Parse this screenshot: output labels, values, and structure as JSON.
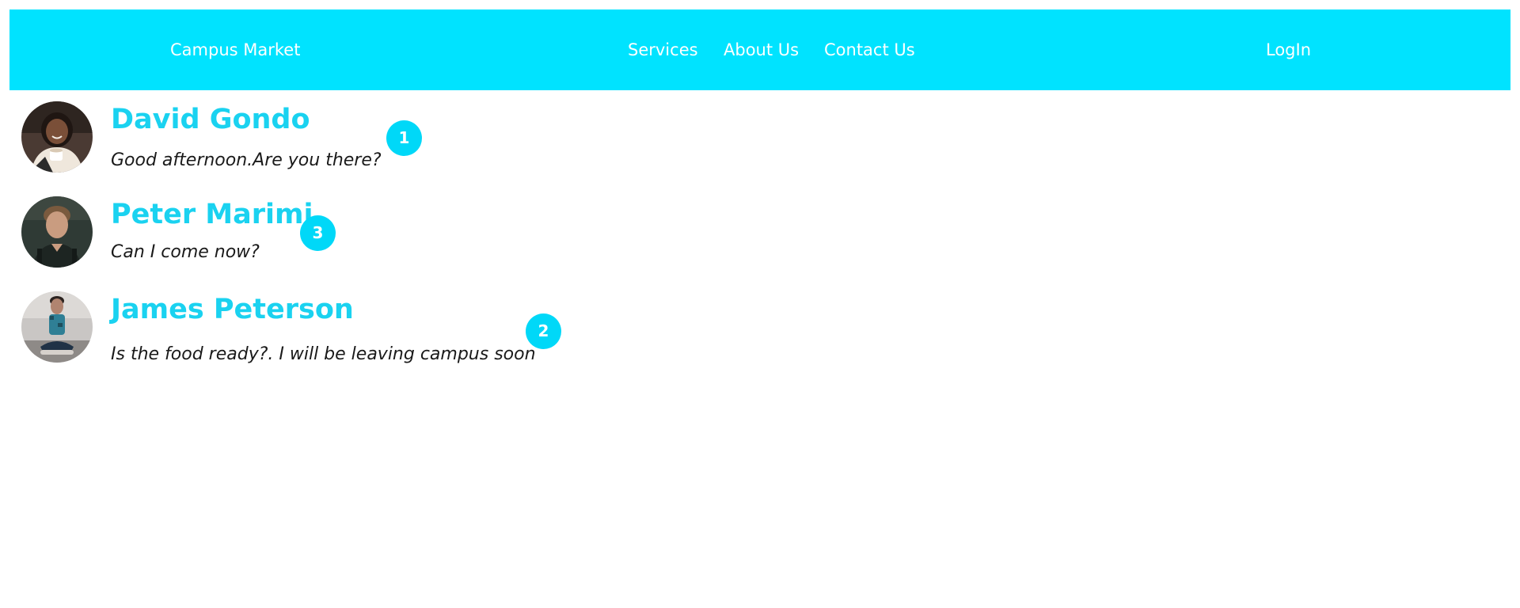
{
  "navbar": {
    "brand": "Campus Market",
    "links": [
      "Services",
      "About Us",
      "Contact Us"
    ],
    "login": "LogIn"
  },
  "conversations": [
    {
      "name": "David Gondo",
      "message": "Good afternoon.Are you there?",
      "unread": "1"
    },
    {
      "name": "Peter Marimi",
      "message": "Can I come now?",
      "unread": "3"
    },
    {
      "name": "James Peterson",
      "message": "Is the food ready?. I will be leaving campus soon",
      "unread": "2"
    }
  ],
  "colors": {
    "accent": "#00e3ff",
    "name_text": "#1ad2f0",
    "badge": "#00d8f8",
    "message_text": "#1a1a1a"
  }
}
